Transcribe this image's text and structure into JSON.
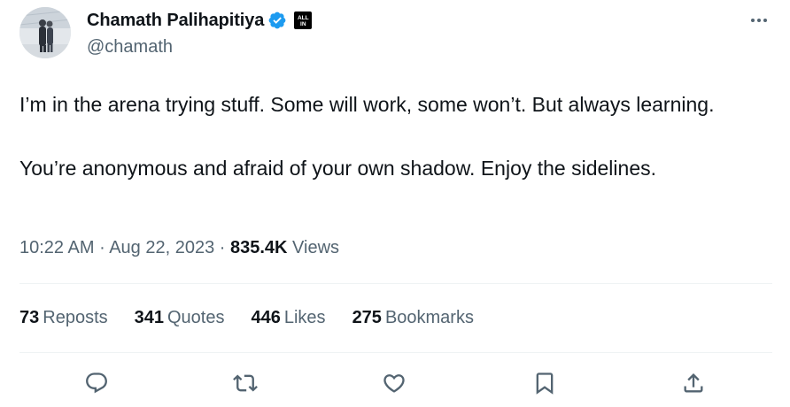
{
  "author": {
    "display_name": "Chamath Palihapitiya",
    "handle": "@chamath",
    "verified_icon": "verified-badge-icon",
    "affiliate_badge": "ALL IN"
  },
  "tweet": {
    "paragraphs": [
      "I’m in the arena trying stuff. Some will work, some won’t. But always learning.",
      "You’re anonymous and afraid of your own shadow. Enjoy the sidelines."
    ],
    "time": "10:22 AM",
    "date": "Aug 22, 2023",
    "separator": "·",
    "views_count": "835.4K",
    "views_label": "Views"
  },
  "stats": {
    "reposts": {
      "count": "73",
      "label": "Reposts"
    },
    "quotes": {
      "count": "341",
      "label": "Quotes"
    },
    "likes": {
      "count": "446",
      "label": "Likes"
    },
    "bookmarks": {
      "count": "275",
      "label": "Bookmarks"
    }
  },
  "actions": [
    "reply-icon",
    "repost-icon",
    "like-icon",
    "bookmark-icon",
    "share-icon"
  ],
  "colors": {
    "text_primary": "#0f1419",
    "text_secondary": "#536471",
    "verified_blue": "#1d9bf0",
    "divider": "#eff3f4"
  }
}
